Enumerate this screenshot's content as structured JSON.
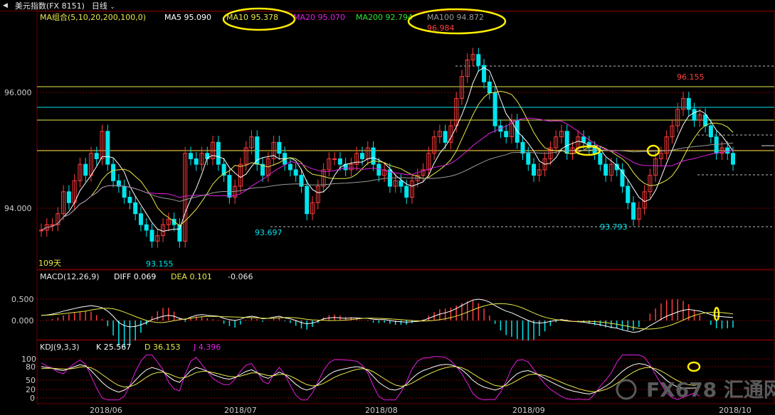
{
  "title_bar": {
    "back_glyph": "◀",
    "instrument": "美元指数(FX 8151)",
    "period": "日线",
    "period_chevron": "chevron-down-icon"
  },
  "colors": {
    "background": "#000000",
    "grid_red": "#7a0000",
    "up_candle": "#ff3c3c",
    "down_candle": "#00e5ee",
    "ma5": "#ffffff",
    "ma10": "#e8e84a",
    "ma20": "#e020e0",
    "ma200": "#2ee62e",
    "ma100": "#9a9a9a",
    "ellipse": "#ffee00",
    "watermark": "#6a6a6a"
  },
  "main_panel": {
    "indicator_label": "MA组合(5,10,20,200,100,0)",
    "legend": [
      {
        "label": "MA5",
        "value": "95.090",
        "color": "#ffffff"
      },
      {
        "label": "MA10",
        "value": "95.378",
        "color": "#e8e84a"
      },
      {
        "label": "MA20",
        "value": "95.070",
        "color": "#e020e0"
      },
      {
        "label": "MA200",
        "value": "92.794",
        "color": "#2ee62e"
      },
      {
        "label": "MA100",
        "value": "94.872",
        "color": "#9a9a9a"
      }
    ],
    "y_ticks": [
      "96.000",
      "94.000"
    ],
    "annotations": {
      "high_main": "96.984",
      "high_right": "96.155",
      "low_left": "93.155",
      "low_mid": "93.697",
      "low_right": "93.793",
      "days": "109天"
    }
  },
  "macd_panel": {
    "label": "MACD(12,26,9)",
    "diff": "DIFF 0.069",
    "dea": "DEA 0.101",
    "macd": "-0.066",
    "y_ticks": [
      "0.500",
      "0.000"
    ]
  },
  "kdj_panel": {
    "label": "KDJ(9,3,3)",
    "k": "K 25.567",
    "d": "D 36.153",
    "j": "J 4.396",
    "y_ticks": [
      "100",
      "80",
      "50",
      "20",
      "0"
    ]
  },
  "x_axis": [
    "2018/06",
    "2018/07",
    "2018/08",
    "2018/09",
    "2018/10"
  ],
  "watermark": "FX678 汇通网",
  "chart_data": {
    "type": "candlestick",
    "ylim": [
      92.9,
      97.3
    ],
    "close": [
      93.6,
      93.7,
      93.7,
      93.9,
      94.3,
      94.1,
      94.5,
      94.8,
      94.6,
      95.0,
      94.9,
      95.4,
      94.8,
      94.5,
      94.4,
      94.2,
      94.1,
      93.9,
      93.7,
      93.6,
      93.4,
      93.5,
      93.7,
      93.8,
      93.7,
      93.4,
      95.0,
      94.9,
      94.8,
      95.0,
      94.9,
      95.2,
      94.8,
      94.6,
      94.2,
      94.4,
      94.8,
      95.1,
      95.3,
      94.8,
      94.6,
      94.9,
      95.2,
      95.0,
      94.8,
      94.7,
      94.6,
      94.4,
      93.9,
      94.1,
      94.4,
      94.7,
      94.9,
      94.9,
      94.8,
      94.7,
      94.8,
      95.0,
      94.9,
      95.1,
      94.8,
      94.6,
      94.7,
      94.4,
      94.5,
      94.4,
      94.2,
      94.5,
      94.6,
      94.7,
      95.0,
      95.3,
      95.4,
      95.2,
      95.5,
      96.0,
      96.4,
      96.7,
      96.8,
      96.6,
      96.3,
      96.1,
      95.5,
      95.4,
      95.3,
      95.6,
      95.2,
      95.0,
      94.8,
      94.6,
      94.7,
      94.9,
      95.1,
      95.3,
      95.4,
      95.0,
      95.1,
      95.3,
      95.2,
      95.1,
      95.0,
      94.8,
      94.6,
      94.8,
      94.7,
      94.4,
      94.1,
      93.8,
      94.0,
      94.3,
      94.6,
      94.9,
      95.0,
      95.3,
      95.5,
      95.8,
      96.0,
      95.8,
      95.6,
      95.7,
      95.5,
      95.3,
      95.0,
      95.1,
      95.0,
      94.8
    ],
    "macd_diff": [
      0.12,
      0.13,
      0.15,
      0.18,
      0.22,
      0.25,
      0.28,
      0.31,
      0.33,
      0.35,
      0.33,
      0.3,
      0.22,
      0.1,
      -0.05,
      -0.12,
      -0.15,
      -0.14,
      -0.1,
      -0.05,
      0.02,
      0.06,
      0.1,
      0.12,
      0.1,
      0.05,
      0.02,
      0.08,
      0.12,
      0.14,
      0.12,
      0.11,
      0.1,
      0.05,
      0.02,
      0.0,
      0.03,
      0.08,
      0.1,
      0.08,
      0.04,
      0.05,
      0.08,
      0.1,
      0.06,
      0.04,
      0.0,
      -0.05,
      -0.08,
      -0.06,
      -0.02,
      0.04,
      0.06,
      0.07,
      0.06,
      0.05,
      0.06,
      0.06,
      0.05,
      0.05,
      0.03,
      0.02,
      0.02,
      0.0,
      -0.02,
      -0.03,
      -0.04,
      -0.03,
      -0.02,
      0.0,
      0.05,
      0.1,
      0.15,
      0.18,
      0.22,
      0.28,
      0.35,
      0.42,
      0.48,
      0.5,
      0.48,
      0.43,
      0.35,
      0.28,
      0.22,
      0.18,
      0.12,
      0.06,
      0.0,
      -0.05,
      -0.06,
      -0.05,
      -0.02,
      0.0,
      0.02,
      0.0,
      -0.02,
      -0.03,
      -0.04,
      -0.06,
      -0.08,
      -0.1,
      -0.13,
      -0.16,
      -0.18,
      -0.22,
      -0.25,
      -0.28,
      -0.26,
      -0.2,
      -0.12,
      -0.05,
      0.03,
      0.1,
      0.15,
      0.2,
      0.24,
      0.26,
      0.24,
      0.22,
      0.18,
      0.14,
      0.1,
      0.09,
      0.08,
      0.07
    ],
    "kdj_k": [
      80,
      78,
      76,
      72,
      70,
      75,
      80,
      85,
      82,
      70,
      55,
      40,
      28,
      20,
      15,
      20,
      30,
      45,
      60,
      72,
      78,
      74,
      68,
      55,
      45,
      40,
      55,
      70,
      78,
      74,
      68,
      60,
      55,
      50,
      48,
      52,
      60,
      68,
      72,
      65,
      55,
      50,
      58,
      66,
      60,
      48,
      35,
      25,
      20,
      25,
      35,
      48,
      60,
      68,
      72,
      75,
      78,
      80,
      78,
      70,
      55,
      40,
      30,
      22,
      20,
      25,
      35,
      50,
      62,
      70,
      75,
      80,
      84,
      86,
      85,
      80,
      72,
      60,
      45,
      35,
      28,
      24,
      20,
      25,
      35,
      50,
      62,
      68,
      70,
      65,
      58,
      50,
      42,
      35,
      28,
      22,
      18,
      15,
      12,
      10,
      14,
      22,
      30,
      40,
      55,
      68,
      78,
      85,
      88,
      86,
      80,
      70,
      58,
      45,
      35,
      28,
      26,
      25,
      25.5,
      25.6
    ],
    "kdj_d": [
      75,
      76,
      76,
      75,
      74,
      74,
      76,
      79,
      80,
      77,
      70,
      60,
      50,
      40,
      32,
      28,
      29,
      34,
      43,
      53,
      61,
      65,
      66,
      62,
      56,
      51,
      52,
      58,
      65,
      68,
      68,
      65,
      62,
      58,
      55,
      54,
      56,
      60,
      64,
      64,
      61,
      57,
      57,
      60,
      60,
      56,
      49,
      41,
      34,
      31,
      32,
      37,
      45,
      53,
      59,
      64,
      69,
      73,
      75,
      73,
      67,
      58,
      49,
      40,
      33,
      30,
      32,
      38,
      46,
      54,
      61,
      67,
      73,
      77,
      80,
      80,
      77,
      71,
      62,
      53,
      45,
      38,
      32,
      30,
      31,
      37,
      45,
      53,
      59,
      61,
      60,
      57,
      52,
      46,
      40,
      34,
      29,
      24,
      20,
      17,
      16,
      18,
      22,
      28,
      37,
      47,
      57,
      66,
      73,
      77,
      78,
      75,
      69,
      61,
      52,
      44,
      38,
      34,
      32,
      36.2
    ],
    "x_labels": [
      "2018/06",
      "2018/07",
      "2018/08",
      "2018/09",
      "2018/10"
    ]
  }
}
